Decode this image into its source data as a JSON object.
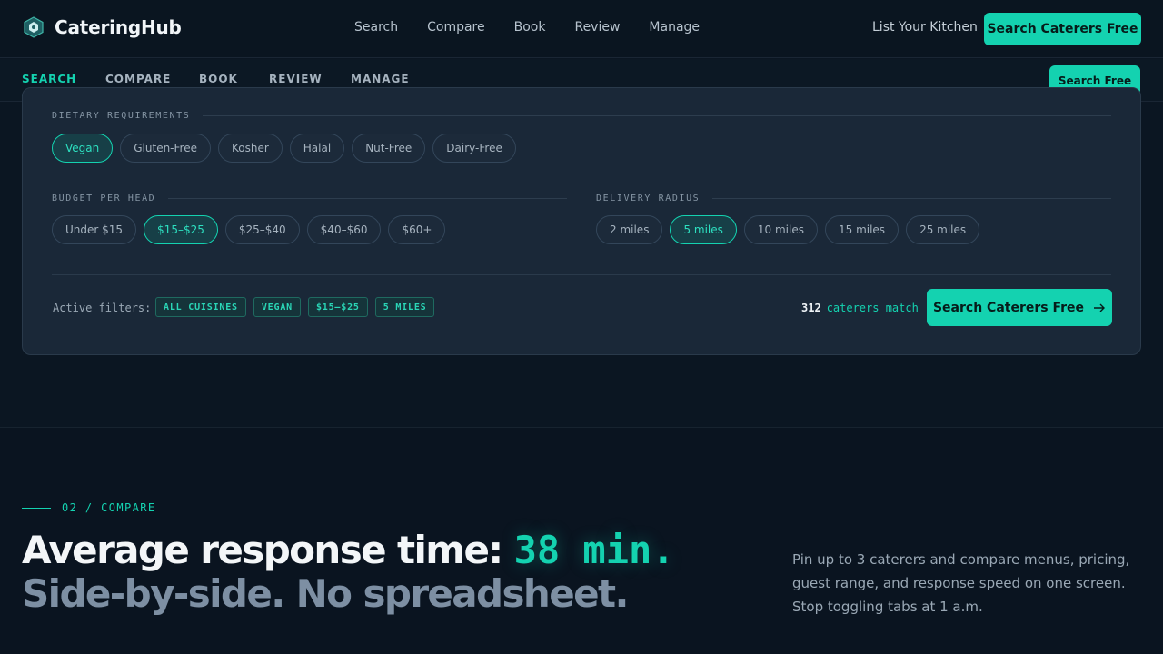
{
  "brand": {
    "name": "CateringHub",
    "accent": "#14d2b0"
  },
  "header": {
    "nav": [
      "Search",
      "Compare",
      "Book",
      "Review",
      "Manage"
    ],
    "list_link": "List Your Kitchen",
    "cta": "Search Caterers Free"
  },
  "subnav": {
    "tabs": [
      "SEARCH",
      "COMPARE",
      "BOOK",
      "REVIEW",
      "MANAGE"
    ],
    "active_tab": "SEARCH",
    "cta": "Search Free"
  },
  "filters": {
    "dietary": {
      "label": "DIETARY REQUIREMENTS",
      "options": [
        "Vegan",
        "Gluten-Free",
        "Kosher",
        "Halal",
        "Nut-Free",
        "Dairy-Free"
      ],
      "selected": "Vegan"
    },
    "budget": {
      "label": "BUDGET PER HEAD",
      "options": [
        "Under $15",
        "$15–$25",
        "$25–$40",
        "$40–$60",
        "$60+"
      ],
      "selected": "$15–$25"
    },
    "radius": {
      "label": "DELIVERY RADIUS",
      "options": [
        "2 miles",
        "5 miles",
        "10 miles",
        "15 miles",
        "25 miles"
      ],
      "selected": "5 miles"
    },
    "active_label": "Active filters:",
    "active_tags": [
      "ALL CUISINES",
      "VEGAN",
      "$15–$25",
      "5 MILES"
    ],
    "match_count": "312",
    "match_text": "caterers match",
    "search_button": "Search Caterers Free"
  },
  "compare_section": {
    "kicker": "02 / COMPARE",
    "headline_prefix": "Average response time:",
    "headline_accent": "38 min.",
    "headline_line2": "Side-by-side. No spreadsheet.",
    "blurb": "Pin up to 3 caterers and compare menus, pricing, guest range, and response speed on one screen. Stop toggling tabs at 1 a.m."
  }
}
